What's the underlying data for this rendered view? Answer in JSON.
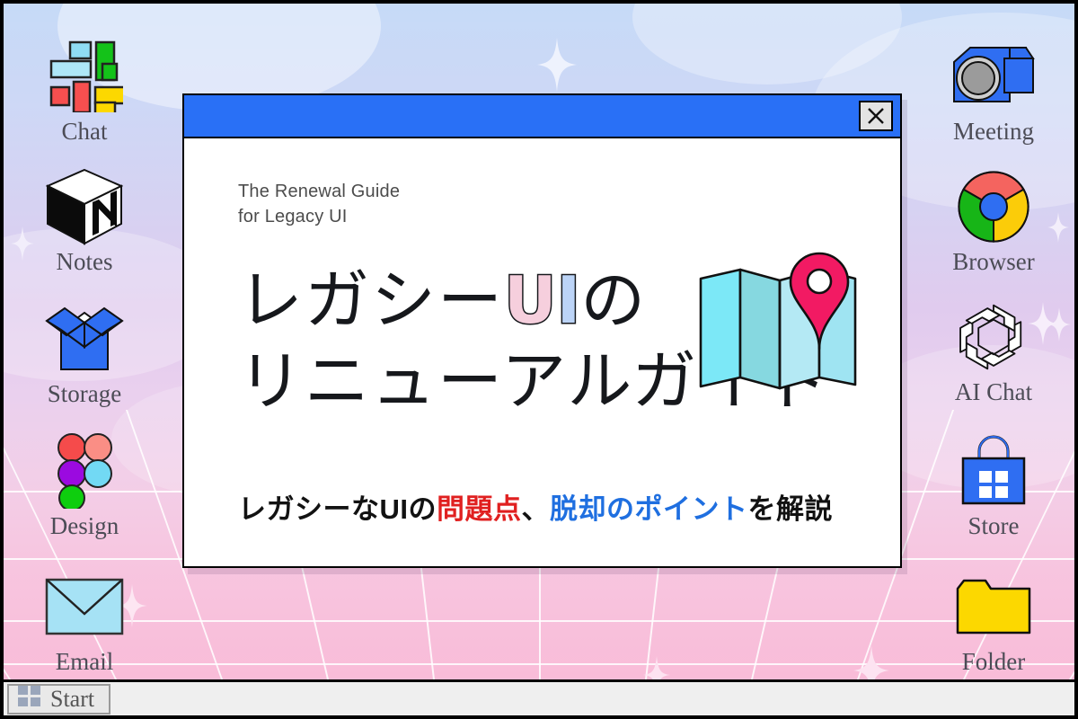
{
  "window": {
    "titlebar_color": "#2970f6",
    "close_label": "×",
    "eyebrow": "The Renewal Guide\nfor Legacy UI",
    "headline": {
      "line1_pre": "レガシー",
      "line1_u": "U",
      "line1_i": "I",
      "line1_post": "の",
      "line2": "リニューアルガイド"
    },
    "subline": {
      "part1": "レガシーなUIの",
      "highlight_red": "問題点",
      "part2": "、",
      "highlight_blue": "脱却のポイント",
      "part3": "を解説",
      "red_color": "#e02020",
      "blue_color": "#1f6fe0"
    },
    "illustration": "folded-map-with-pin"
  },
  "desktop": {
    "left_icons": [
      {
        "label": "Chat",
        "icon": "slack-blocks-icon"
      },
      {
        "label": "Notes",
        "icon": "notion-cube-icon"
      },
      {
        "label": "Storage",
        "icon": "dropbox-open-box-icon"
      },
      {
        "label": "Design",
        "icon": "figma-circles-icon"
      },
      {
        "label": "Email",
        "icon": "envelope-icon"
      }
    ],
    "right_icons": [
      {
        "label": "Meeting",
        "icon": "video-camera-icon"
      },
      {
        "label": "Browser",
        "icon": "chrome-wheel-icon"
      },
      {
        "label": "AI Chat",
        "icon": "openai-knot-icon"
      },
      {
        "label": "Store",
        "icon": "shopping-bag-windows-icon"
      },
      {
        "label": "Folder",
        "icon": "folder-icon"
      }
    ]
  },
  "taskbar": {
    "start_label": "Start",
    "start_icon": "windows-panes-icon"
  }
}
